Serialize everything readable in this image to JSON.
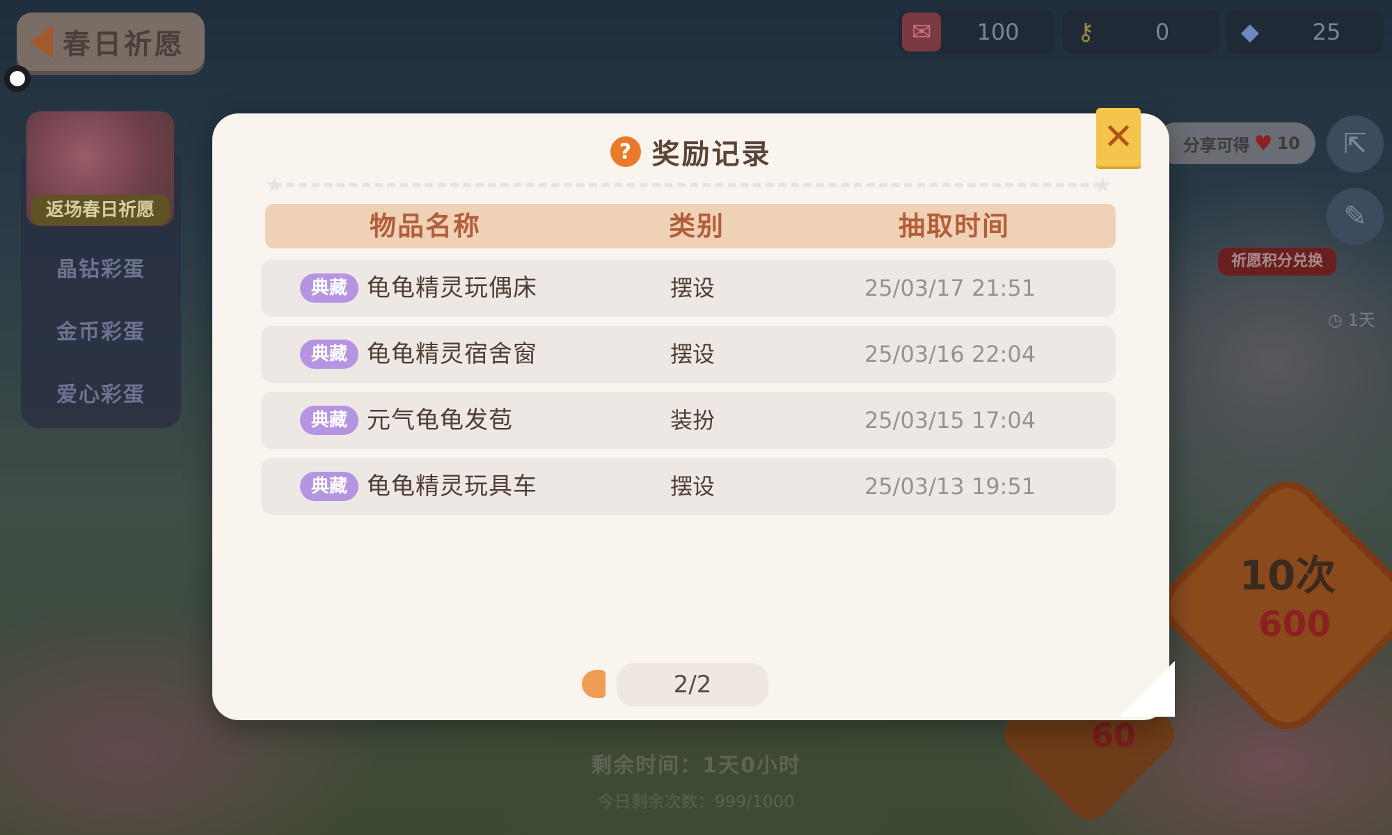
{
  "header": {
    "title": "春日祈愿"
  },
  "side_menu": {
    "banner_label": "返场春日祈愿",
    "items": [
      "晶钻彩蛋",
      "金币彩蛋",
      "爱心彩蛋"
    ]
  },
  "currencies": [
    {
      "icon": "ticket-icon",
      "value": "100"
    },
    {
      "icon": "key-icon",
      "value": "0"
    },
    {
      "icon": "gem-plus-icon",
      "value": "25"
    }
  ],
  "right_panel": {
    "share_text": "分享可得",
    "share_reward": "10",
    "exchange_tag": "祈愿积分兑换",
    "timer": "1天",
    "draw10_label": "10次",
    "draw10_cost": "600",
    "draw1_cost": "60"
  },
  "footer": {
    "remaining_time": "剩余时间：1天0小时",
    "remaining_count": "今日剩余次数：999/1000"
  },
  "modal": {
    "title": "奖励记录",
    "columns": [
      "物品名称",
      "类别",
      "抽取时间"
    ],
    "rows": [
      {
        "badge": "典藏",
        "name": "龟龟精灵玩偶床",
        "category": "摆设",
        "time": "25/03/17 21:51"
      },
      {
        "badge": "典藏",
        "name": "龟龟精灵宿舍窗",
        "category": "摆设",
        "time": "25/03/16 22:04"
      },
      {
        "badge": "典藏",
        "name": "元气龟龟发苞",
        "category": "装扮",
        "time": "25/03/15 17:04"
      },
      {
        "badge": "典藏",
        "name": "龟龟精灵玩具车",
        "category": "摆设",
        "time": "25/03/13 19:51"
      }
    ],
    "pager": {
      "text": "2/2"
    }
  },
  "colors": {
    "modal_bg": "#faf4ef",
    "header_bg": "#efd2b6",
    "header_text": "#b25e3a",
    "badge_bg": "#b594e2",
    "accent_orange": "#e87a2a",
    "close_bg": "#f5c44a"
  }
}
